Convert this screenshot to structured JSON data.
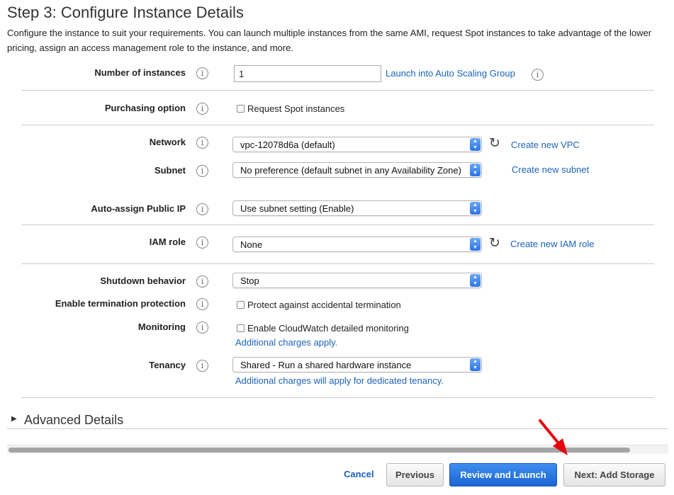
{
  "page": {
    "title": "Step 3: Configure Instance Details",
    "description": "Configure the instance to suit your requirements. You can launch multiple instances from the same AMI, request Spot instances to take advantage of the lower pricing, assign an access management role to the instance, and more."
  },
  "fields": {
    "number_of_instances": {
      "label": "Number of instances",
      "value": "1",
      "link": "Launch into Auto Scaling Group"
    },
    "purchasing_option": {
      "label": "Purchasing option",
      "checkbox": "Request Spot instances"
    },
    "network": {
      "label": "Network",
      "value": "vpc-12078d6a (default)",
      "link": "Create new VPC"
    },
    "subnet": {
      "label": "Subnet",
      "value": "No preference (default subnet in any Availability Zone)",
      "link": "Create new subnet"
    },
    "public_ip": {
      "label": "Auto-assign Public IP",
      "value": "Use subnet setting (Enable)"
    },
    "iam_role": {
      "label": "IAM role",
      "value": "None",
      "link": "Create new IAM role"
    },
    "shutdown": {
      "label": "Shutdown behavior",
      "value": "Stop"
    },
    "termination": {
      "label": "Enable termination protection",
      "checkbox": "Protect against accidental termination"
    },
    "monitoring": {
      "label": "Monitoring",
      "checkbox": "Enable CloudWatch detailed monitoring",
      "note": "Additional charges apply."
    },
    "tenancy": {
      "label": "Tenancy",
      "value": "Shared - Run a shared hardware instance",
      "note": "Additional charges will apply for dedicated tenancy."
    }
  },
  "advanced": {
    "label": "Advanced Details"
  },
  "footer": {
    "cancel": "Cancel",
    "previous": "Previous",
    "review": "Review and Launch",
    "next": "Next: Add Storage"
  },
  "icons": {
    "info": "info-icon",
    "refresh": "refresh-icon",
    "caret": "caret-right-icon",
    "annotation": "red-arrow-icon"
  },
  "colors": {
    "link": "#1c62b9",
    "primary_button": "#1b64d3",
    "annotation_arrow": "#e8000b"
  }
}
